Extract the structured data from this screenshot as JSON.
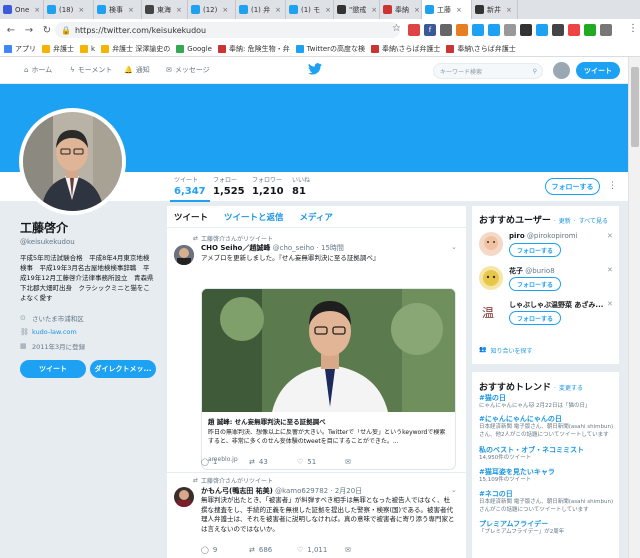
{
  "browser": {
    "tabs": [
      {
        "label": "One",
        "color": "#3b5bdb",
        "icon": "vivaldi-icon"
      },
      {
        "label": "(18)",
        "color": "#1da1f2",
        "icon": "twitter-icon"
      },
      {
        "label": "検事",
        "color": "#1da1f2",
        "icon": "twitter-icon"
      },
      {
        "label": "東海",
        "color": "#444444",
        "icon": "tk-icon"
      },
      {
        "label": "(12)",
        "color": "#1da1f2",
        "icon": "twitter-icon"
      },
      {
        "label": "(1) 弁",
        "color": "#1da1f2",
        "icon": "twitter-icon"
      },
      {
        "label": "(1) モ",
        "color": "#1da1f2",
        "icon": "twitter-icon"
      },
      {
        "label": "\"懲戒",
        "color": "#333333",
        "icon": "github-icon"
      },
      {
        "label": "奉納",
        "color": "#cc3333",
        "icon": "pin-icon"
      },
      {
        "label": "工藤",
        "color": "#1da1f2",
        "icon": "twitter-icon",
        "active": true
      },
      {
        "label": "新井",
        "color": "#333333",
        "icon": "f-icon"
      }
    ],
    "url": "https://twitter.com/keisukekudou",
    "bookmarks": [
      "アプリ",
      "弁護士",
      "k",
      "弁護士 深澤諭史の",
      "Google",
      "奉納: 危険生物・弁",
      "Twitterの高度な検",
      "奉納\\さらば弁護士",
      "奉納\\さらば弁護士"
    ]
  },
  "twitter_nav": {
    "home": "ホーム",
    "moments": "モーメント",
    "notifications": "通知",
    "messages": "メッセージ",
    "search_placeholder": "キーワード検索",
    "tweet_button": "ツイート"
  },
  "profile": {
    "name": "工藤啓介",
    "handle": "@keisukekudou",
    "bio": "平成5年司法試験合格　平成8年4月東京地検検事　平成19年3月名古屋地検検事辞職　平成19年12月工藤啓介法律事務所設立　青森県下北郡大畑町出身　クラシックミニと猫をこよなく愛す",
    "location": "さいたま市浦和区",
    "website": "kudo-law.com",
    "joined": "2011年3月に登録",
    "tweet_button": "ツイート",
    "dm_button": "ダイレクトメッ...",
    "stats": [
      {
        "label": "ツイート",
        "value": "6,347"
      },
      {
        "label": "フォロー",
        "value": "1,525"
      },
      {
        "label": "フォロワー",
        "value": "1,210"
      },
      {
        "label": "いいね",
        "value": "81"
      }
    ],
    "follow_button": "フォローする"
  },
  "timeline": {
    "tabs": [
      "ツイート",
      "ツイートと返信",
      "メディア"
    ],
    "tweets": [
      {
        "retweet_note": "工藤啓介さんがリツイート",
        "author": "CHO Seiho／趙誠峰",
        "handle": "@cho_seiho",
        "time": "15時間",
        "text": "アメブロを更新しました。『せん妄無罪判決に至る証拠調べ』",
        "card_title": "趙 誠峰: せん妄無罪判決に至る証拠調べ",
        "card_desc": "昨日の無罪判決、想像以上に反響が大きい。Twitterで「せん妄」というkeywordで検索すると、非常に多くのせん妄体験のtweetを目にすることができた。...",
        "card_domain": "ameblo.jp",
        "replies": "1",
        "retweets": "43",
        "likes": "51"
      },
      {
        "retweet_note": "工藤啓介さんがリツイート",
        "author": "かもん弓(鴨志田 祐美)",
        "handle": "@kamo629782",
        "time": "2月20日",
        "text": "無罪判決が出たとき、「被害者」が糾弾すべき相手は無罪となった被告人ではなく、杜撰な捜査をし、手続的正義を無視した証拠を提出した警察・検察(国)である。被害者代理人弁護士は、それを被害者に説明しなければ。真の意味で被害者に寄り添う専門家とは言えないのではないか。",
        "replies": "9",
        "retweets": "686",
        "likes": "1,011"
      }
    ]
  },
  "suggestions": {
    "title": "おすすめユーザー",
    "refresh": "更新",
    "view_all": "すべて見る",
    "users": [
      {
        "name": "piro",
        "handle": "@pirokopiromi",
        "button": "フォローする"
      },
      {
        "name": "花子",
        "handle": "@burio8",
        "button": "フォローする"
      },
      {
        "name": "しゃぶしゃぶ温野菜 あざみ...",
        "handle": "",
        "button": "フォローする"
      }
    ],
    "find_friends": "知り合いを探す"
  },
  "trends": {
    "title": "おすすめトレンド",
    "change": "変更する",
    "items": [
      {
        "name": "#猫の日",
        "desc": "にゃんにゃんにゃん🐱 2月22日は「猫の日」"
      },
      {
        "name": "#にゃんにゃんにゃんの日",
        "desc": "日本経済新聞 電子版さん、朝日新聞(asahi shimbun)さん、他2人がこの話題についてツイートしています"
      },
      {
        "name": "私のベスト・オブ・ネコミミスト",
        "desc": "14,950件のツイート"
      },
      {
        "name": "#猫耳姿を見たいキャラ",
        "desc": "15,109件のツイート"
      },
      {
        "name": "#ネコの日",
        "desc": "日本経済新聞 電子版さん、朝日新聞(asahi shimbun)さんがこの話題についてツイートしています"
      },
      {
        "name": "プレミアムフライデー",
        "desc": "「プレミアムフライデー」が2周年"
      }
    ]
  }
}
